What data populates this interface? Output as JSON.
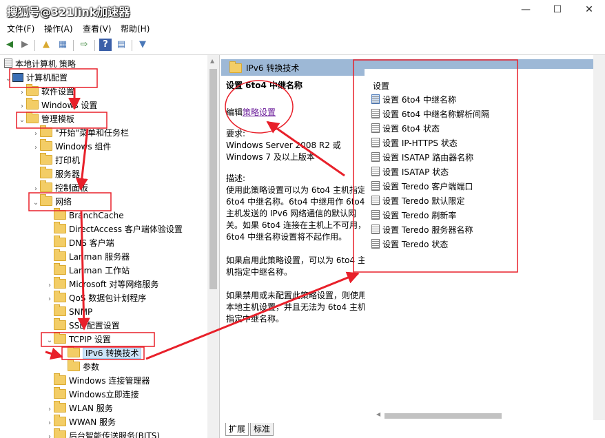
{
  "window": {
    "title": "搜狐号@321link加速器",
    "controls": {
      "minimize": "—",
      "maximize": "☐",
      "close": "✕"
    }
  },
  "menu": [
    "文件(F)",
    "操作(A)",
    "查看(V)",
    "帮助(H)"
  ],
  "tree": {
    "root": "本地计算机 策略",
    "items": [
      {
        "label": "计算机配置",
        "level": 1,
        "expanded": true,
        "icon": "computer-icon"
      },
      {
        "label": "软件设置",
        "level": 2,
        "expanded": false
      },
      {
        "label": "Windows 设置",
        "level": 2,
        "expanded": false
      },
      {
        "label": "管理模板",
        "level": 2,
        "expanded": true
      },
      {
        "label": "\"开始\"菜单和任务栏",
        "level": 3,
        "expanded": false
      },
      {
        "label": "Windows 组件",
        "level": 3,
        "expanded": false
      },
      {
        "label": "打印机",
        "level": 3,
        "expanded": null
      },
      {
        "label": "服务器",
        "level": 3,
        "expanded": null
      },
      {
        "label": "控制面板",
        "level": 3,
        "expanded": false
      },
      {
        "label": "网络",
        "level": 3,
        "expanded": true
      },
      {
        "label": "BranchCache",
        "level": 4,
        "expanded": null
      },
      {
        "label": "DirectAccess 客户端体验设置",
        "level": 4,
        "expanded": null
      },
      {
        "label": "DNS 客户端",
        "level": 4,
        "expanded": null
      },
      {
        "label": "Lanman 服务器",
        "level": 4,
        "expanded": null
      },
      {
        "label": "Lanman 工作站",
        "level": 4,
        "expanded": null
      },
      {
        "label": "Microsoft 对等网络服务",
        "level": 4,
        "expanded": false
      },
      {
        "label": "QoS 数据包计划程序",
        "level": 4,
        "expanded": false
      },
      {
        "label": "SNMP",
        "level": 4,
        "expanded": null
      },
      {
        "label": "SSL 配置设置",
        "level": 4,
        "expanded": null
      },
      {
        "label": "TCPIP 设置",
        "level": 4,
        "expanded": true
      },
      {
        "label": "IPv6 转换技术",
        "level": 5,
        "expanded": null,
        "selected": true
      },
      {
        "label": "参数",
        "level": 5,
        "expanded": null
      },
      {
        "label": "Windows 连接管理器",
        "level": 4,
        "expanded": null
      },
      {
        "label": "Windows立即连接",
        "level": 4,
        "expanded": null
      },
      {
        "label": "WLAN 服务",
        "level": 4,
        "expanded": false
      },
      {
        "label": "WWAN 服务",
        "level": 4,
        "expanded": false
      },
      {
        "label": "后台智能传送服务(BITS)",
        "level": 4,
        "expanded": false
      }
    ]
  },
  "right": {
    "header": "IPv6 转换技术",
    "setting_title": "设置 6to4 中继名称",
    "edit_prefix": "编辑",
    "edit_link": "策略设置",
    "requirements_label": "要求:",
    "requirements": "Windows Server 2008 R2 或 Windows 7 及以上版本",
    "description_label": "描述:",
    "description": "使用此策略设置可以为 6to4 主机指定 6to4 中继名称。6to4 中继用作 6to4 主机发送的 IPv6 网络通信的默认网关。如果 6to4 连接在主机上不可用，6to4 中继名称设置将不起作用。",
    "enabled_text": "如果启用此策略设置，可以为 6to4 主机指定中继名称。",
    "disabled_text": "如果禁用或未配置此策略设置，则使用本地主机设置，并且无法为 6to4 主机指定中继名称。",
    "list_header": "设置",
    "settings": [
      "设置 6to4 中继名称",
      "设置 6to4 中继名称解析间隔",
      "设置 6to4 状态",
      "设置 IP-HTTPS 状态",
      "设置 ISATAP 路由器名称",
      "设置 ISATAP 状态",
      "设置 Teredo 客户端端口",
      "设置 Teredo 默认限定",
      "设置 Teredo 刷新率",
      "设置 Teredo 服务器名称",
      "设置 Teredo 状态"
    ],
    "tabs": [
      "扩展",
      "标准"
    ]
  },
  "colors": {
    "annotation": "#e8202a",
    "header": "#9db8d6",
    "selection": "#cde4f7"
  }
}
